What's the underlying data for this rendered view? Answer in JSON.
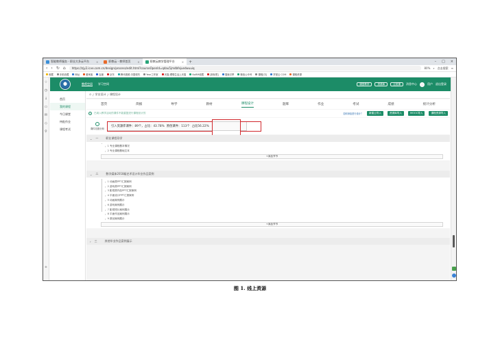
{
  "browser": {
    "tabs": [
      {
        "label": "智能教师服务 - 职业大多云平台",
        "color": "#3a8fd8",
        "active": false
      },
      {
        "label": "职教云 - 教师首页",
        "color": "#e96a2a",
        "active": false
      },
      {
        "label": "职教云教学管理平台",
        "color": "#2aa57a",
        "active": true
      }
    ],
    "url": "https://zjy2.icve.com.cn/design/process/edit.html?courseOpenId=qdau5jmdbfejuedwuuiq",
    "zoom": "80%",
    "search_hint": "点击搜索",
    "bookmarks": [
      "收藏",
      "手机收藏",
      "网址",
      "爱淘宝",
      "百度",
      "京东",
      "腾讯视频-中国领先",
      "Year工作室",
      "天猫-理想生活上天猫",
      "NoRM收藏",
      "[新标签]",
      "搜索引擎",
      "微信公众号",
      "课程[中]",
      "学堂云 COM",
      "课程资源",
      "在线课程",
      "更多"
    ]
  },
  "header": {
    "nav": [
      "教师空间",
      "学习空间"
    ],
    "buttons": [
      "课堂教学",
      "资源库",
      "云班课",
      "消息中心"
    ],
    "user": "用户",
    "logout": "退出登录"
  },
  "sidebar": {
    "items": [
      "首页",
      "我的课程",
      "今日课堂",
      "待批作业",
      "课程考试"
    ]
  },
  "breadcrumb": {
    "root": "学业设计",
    "current": "课程设计"
  },
  "page_tabs": [
    "首页",
    "简报",
    "导学",
    "教材",
    "课程设计",
    "题库",
    "作业",
    "考试",
    "成绩",
    "统计分析"
  ],
  "active_tab": "课程设计",
  "tip": {
    "text": "已纳入教学活动的课件不能重复进行课程设计的",
    "sync": "如何添加进行设计？",
    "buttons": [
      "新建云导入",
      "资源库导入",
      "MOOC导入",
      "课程资源导入"
    ]
  },
  "stats": {
    "icon_label": "课件总数分析",
    "included": "引入资源库课件：89个，占比：43.78%",
    "original": "原创课件：113个",
    "ratio": "占比56.22%"
  },
  "chapters": [
    {
      "num": "一",
      "title": "职业课程导学",
      "lessons": [
        "1 专业课程基本情况",
        "2 专业课程基础文本"
      ],
      "add_label": "+添加节节"
    },
    {
      "num": "二",
      "title": "数字媒体2018级艺术设计毕业作品案例",
      "lessons": [
        "1 动画类PPT汇报案例",
        "2 游戏类PPT汇报案例",
        "3 影视类作品PPT汇报案例",
        "4 平面设计PPT汇报案例",
        "5 动画案例展示",
        "6 游戏案例展示",
        "7 影视短片案例展示",
        "8 平面作品案例展示",
        "9 原创案例展示"
      ],
      "add_label": "+添加节节"
    },
    {
      "num": "三",
      "title": "其他毕业作品案例展示",
      "lessons": [],
      "add_label": ""
    }
  ],
  "caption": "图 1. 线上资源"
}
